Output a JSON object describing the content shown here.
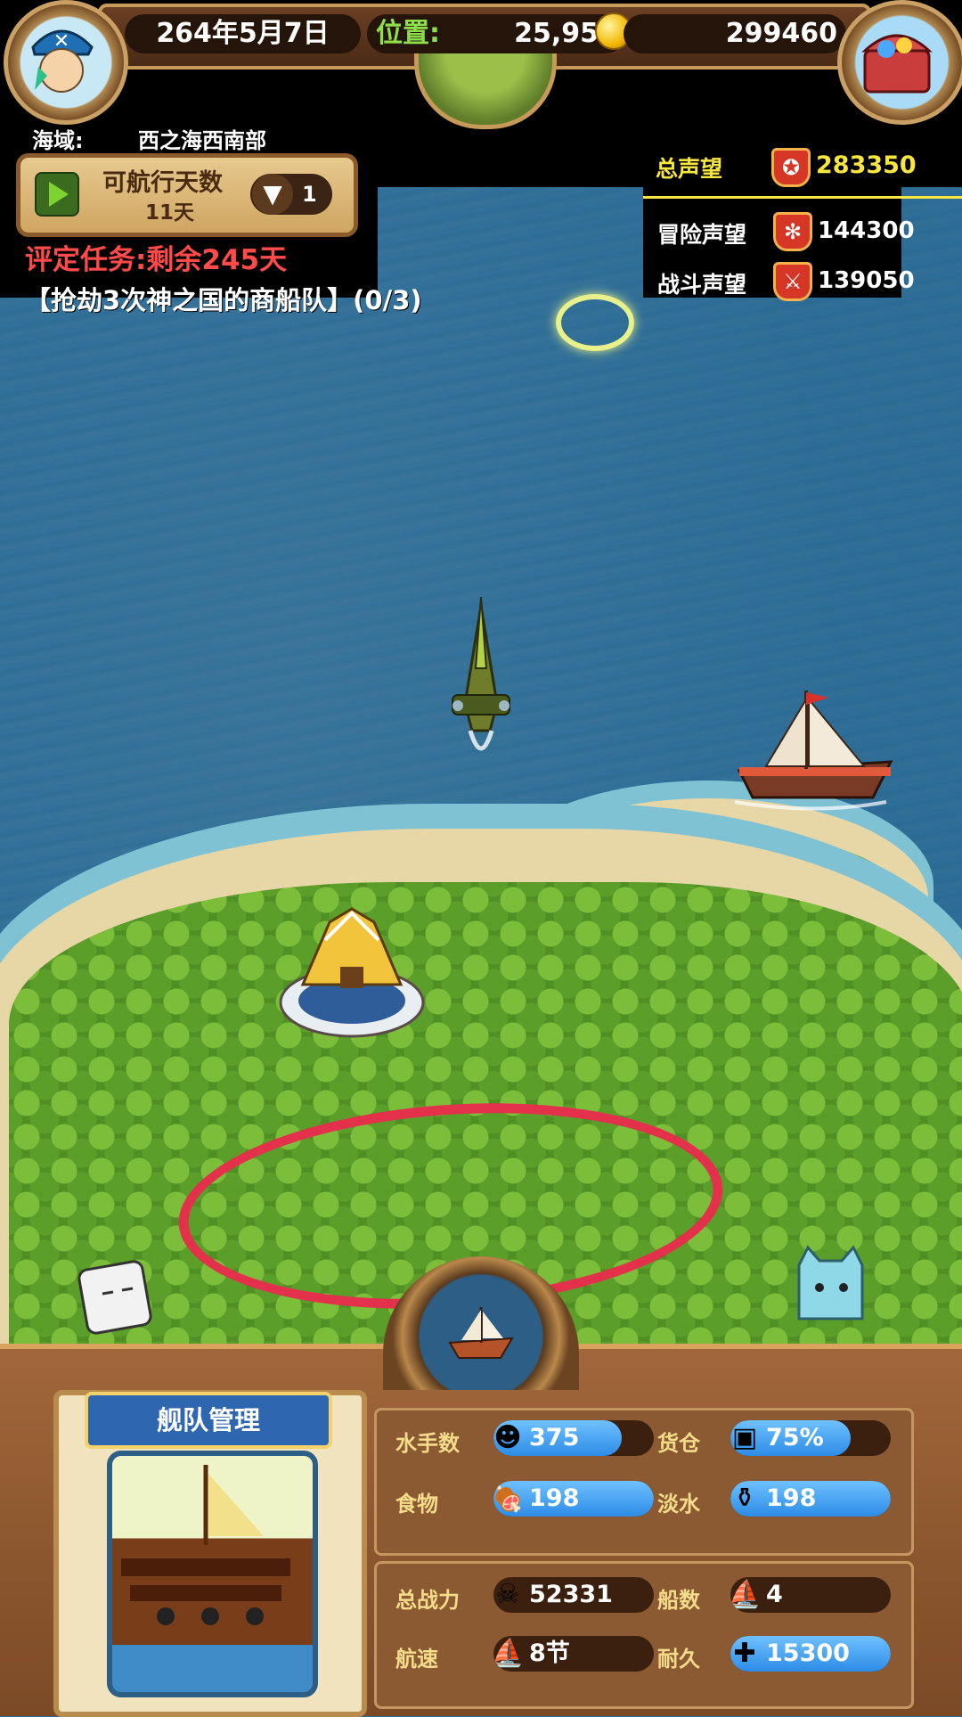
{
  "header": {
    "date": "264年5月7日",
    "position_label": "位置:",
    "position_value": "25,95",
    "gold": "299460"
  },
  "sea_area": {
    "label": "海域:",
    "value": "西之海西南部"
  },
  "navigation": {
    "label": "可航行天数",
    "days": "11天",
    "speed_value": "1"
  },
  "quest": {
    "eval_task": "评定任务:剩余245天",
    "objective": "【抢劫3次神之国的商船队】(0/3)"
  },
  "reputation": {
    "total_label": "总声望",
    "total_value": "283350",
    "adventure_label": "冒险声望",
    "adventure_value": "144300",
    "battle_label": "战斗声望",
    "battle_value": "139050"
  },
  "fleet": {
    "title": "舰队管理",
    "stats": [
      {
        "label": "水手数",
        "value": "375",
        "icon": "sailor-icon",
        "fill": 0.8
      },
      {
        "label": "货仓",
        "value": "75%",
        "icon": "crate-icon",
        "fill": 0.75
      },
      {
        "label": "食物",
        "value": "198",
        "icon": "meat-icon",
        "fill": 1.0
      },
      {
        "label": "淡水",
        "value": "198",
        "icon": "water-jug-icon",
        "fill": 1.0
      },
      {
        "label": "总战力",
        "value": "52331",
        "icon": "crossbones-icon",
        "fill": 0.0
      },
      {
        "label": "船数",
        "value": "4",
        "icon": "ship-icon",
        "fill": 0.0
      },
      {
        "label": "航速",
        "value": "8节",
        "icon": "sail-icon",
        "fill": 0.0
      },
      {
        "label": "耐久",
        "value": "15300",
        "icon": "durability-icon",
        "fill": 1.0
      }
    ]
  },
  "colors": {
    "sea": "#2e6f99",
    "grass": "#4f8f24",
    "annotation_red": "#e3304b",
    "gold_text": "#f7e640",
    "task_red": "#ff4a4a",
    "position_green": "#8ee04a"
  }
}
